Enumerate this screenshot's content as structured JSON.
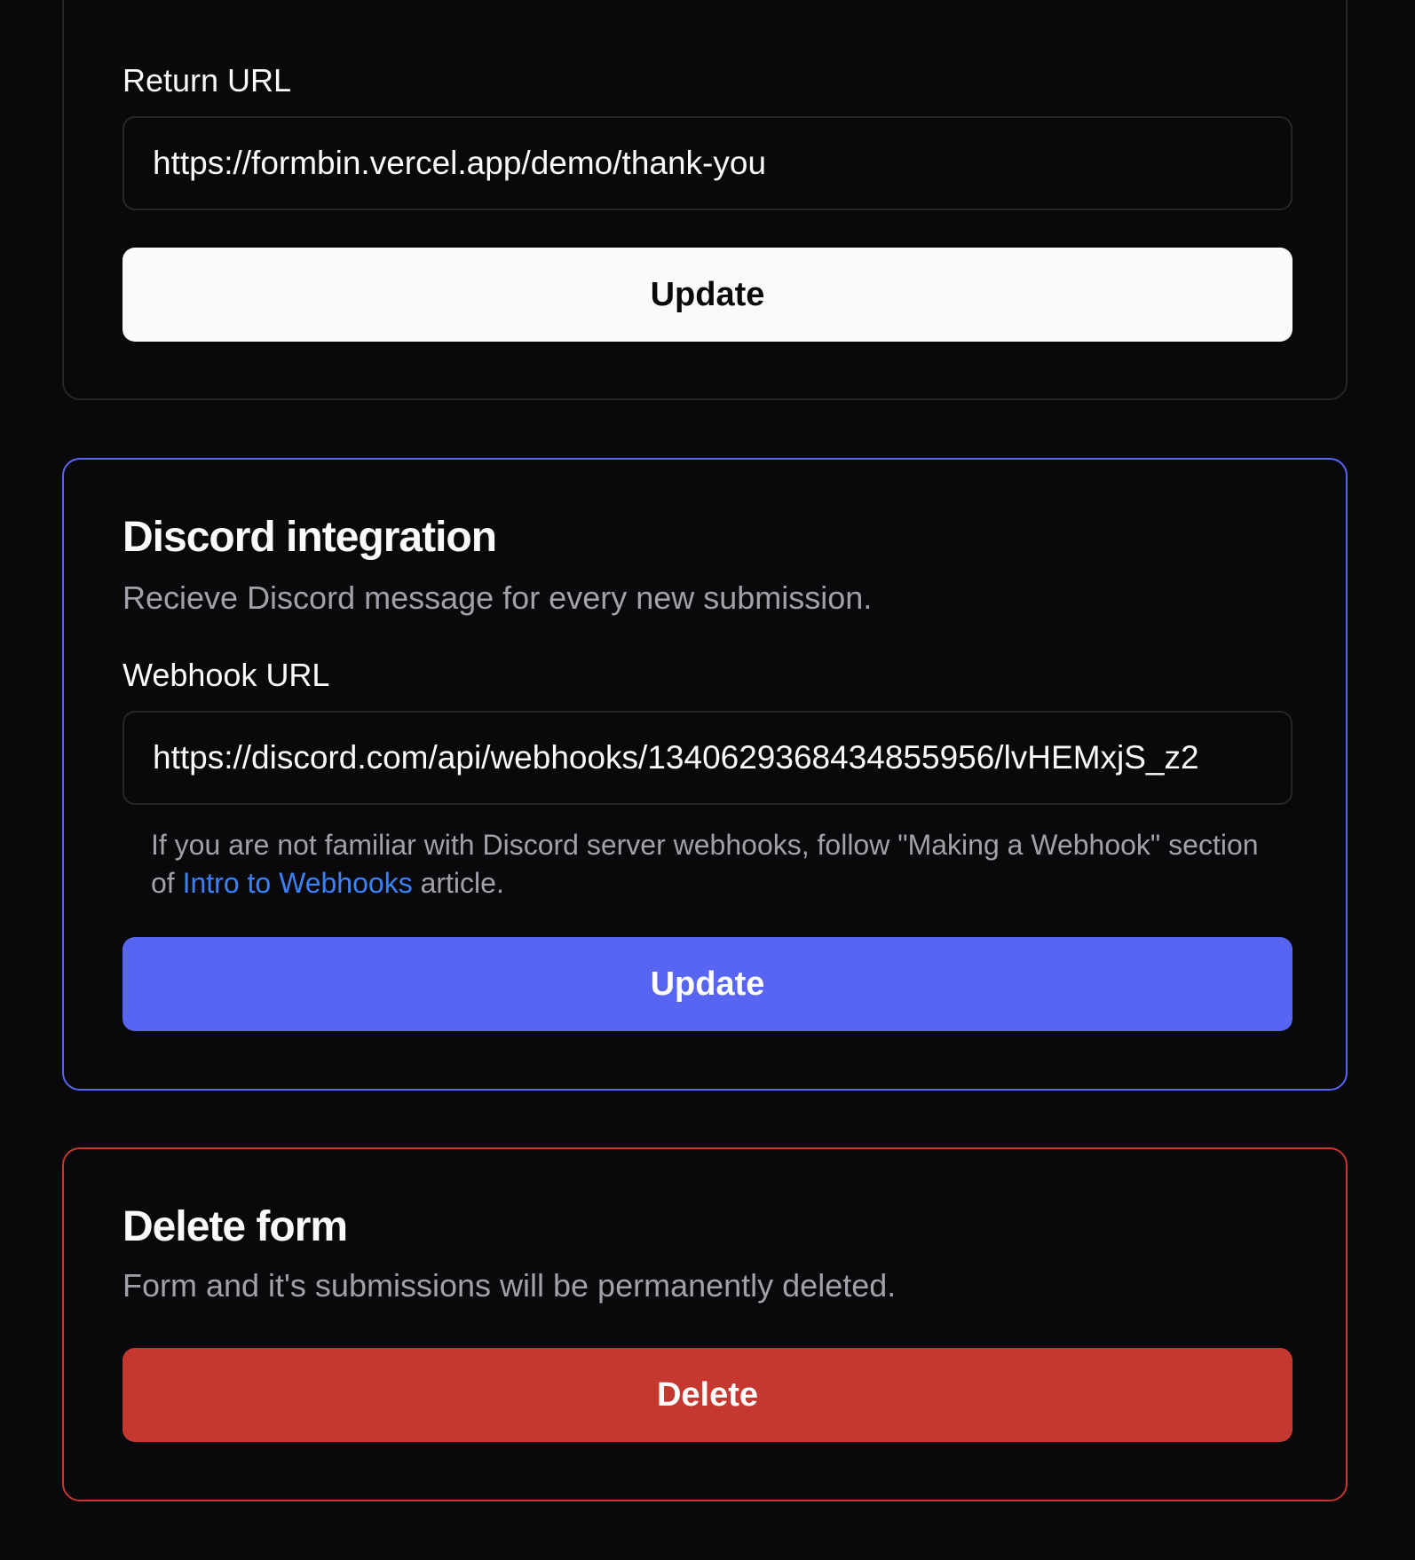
{
  "redirect_card": {
    "return_url_label": "Return URL",
    "return_url_value": "https://formbin.vercel.app/demo/thank-you",
    "update_label": "Update"
  },
  "discord_card": {
    "title": "Discord integration",
    "description": "Recieve Discord message for every new submission.",
    "webhook_label": "Webhook URL",
    "webhook_value": "https://discord.com/api/webhooks/1340629368434855956/lvHEMxjS_z2",
    "help_prefix": "If you are not familiar with Discord server webhooks, follow \"Making a Webhook\" section of ",
    "help_link": "Intro to Webhooks",
    "help_suffix": " article.",
    "update_label": "Update",
    "accent_color": "#5865f2"
  },
  "delete_card": {
    "title": "Delete form",
    "description": "Form and it's submissions will be permanently deleted.",
    "delete_label": "Delete",
    "danger_color": "#c5382f"
  }
}
